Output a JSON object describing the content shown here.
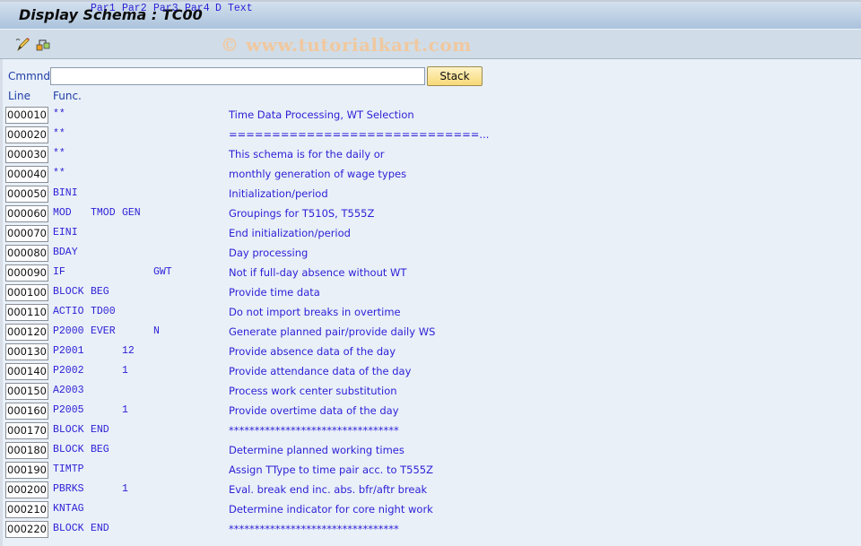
{
  "window": {
    "title": "Display Schema : TC00",
    "watermark": "© www.tutorialkart.com"
  },
  "toolbar": {
    "icons": [
      "display-change-icon",
      "hierarchy-icon"
    ]
  },
  "command": {
    "label": "Cmmnd",
    "value": "",
    "placeholder": "",
    "stack_label": "Stack"
  },
  "columns": {
    "line": "Line",
    "func": "Func.",
    "par1": "Par1",
    "par2": "Par2",
    "par3": "Par3",
    "par4": "Par4",
    "d": "D",
    "text": "Text"
  },
  "rows": [
    {
      "line": "000010",
      "func": "**",
      "par1": "",
      "par2": "",
      "par3": "",
      "par4": "",
      "d": "",
      "text": "Time Data Processing, WT Selection"
    },
    {
      "line": "000020",
      "func": "**",
      "par1": "",
      "par2": "",
      "par3": "",
      "par4": "",
      "d": "",
      "text": "=============================..."
    },
    {
      "line": "000030",
      "func": "**",
      "par1": "",
      "par2": "",
      "par3": "",
      "par4": "",
      "d": "",
      "text": "This schema is for the daily or"
    },
    {
      "line": "000040",
      "func": "**",
      "par1": "",
      "par2": "",
      "par3": "",
      "par4": "",
      "d": "",
      "text": "monthly generation of wage types"
    },
    {
      "line": "000050",
      "func": "BINI",
      "par1": "",
      "par2": "",
      "par3": "",
      "par4": "",
      "d": "",
      "text": "Initialization/period"
    },
    {
      "line": "000060",
      "func": "MOD",
      "par1": "TMOD",
      "par2": "GEN",
      "par3": "",
      "par4": "",
      "d": "",
      "text": "Groupings for T510S, T555Z"
    },
    {
      "line": "000070",
      "func": "EINI",
      "par1": "",
      "par2": "",
      "par3": "",
      "par4": "",
      "d": "",
      "text": "End initialization/period"
    },
    {
      "line": "000080",
      "func": "BDAY",
      "par1": "",
      "par2": "",
      "par3": "",
      "par4": "",
      "d": "",
      "text": "Day processing"
    },
    {
      "line": "000090",
      "func": "IF",
      "par1": "",
      "par2": "",
      "par3": "GWT",
      "par4": "",
      "d": "",
      "text": "Not if full-day absence without WT"
    },
    {
      "line": "000100",
      "func": "BLOCK",
      "par1": "BEG",
      "par2": "",
      "par3": "",
      "par4": "",
      "d": "",
      "text": "Provide time data"
    },
    {
      "line": "000110",
      "func": "ACTIO",
      "par1": "TD00",
      "par2": "",
      "par3": "",
      "par4": "",
      "d": "",
      "text": "Do not import breaks in overtime"
    },
    {
      "line": "000120",
      "func": "P2000",
      "par1": "EVER",
      "par2": "",
      "par3": "N",
      "par4": "",
      "d": "",
      "text": "Generate planned pair/provide daily WS"
    },
    {
      "line": "000130",
      "func": "P2001",
      "par1": "",
      "par2": "12",
      "par3": "",
      "par4": "",
      "d": "",
      "text": "Provide absence data of the day"
    },
    {
      "line": "000140",
      "func": "P2002",
      "par1": "",
      "par2": "1",
      "par3": "",
      "par4": "",
      "d": "",
      "text": "Provide attendance data of the day"
    },
    {
      "line": "000150",
      "func": "A2003",
      "par1": "",
      "par2": "",
      "par3": "",
      "par4": "",
      "d": "",
      "text": "Process work center substitution"
    },
    {
      "line": "000160",
      "func": "P2005",
      "par1": "",
      "par2": "1",
      "par3": "",
      "par4": "",
      "d": "",
      "text": "Provide overtime data of the day"
    },
    {
      "line": "000170",
      "func": "BLOCK",
      "par1": "END",
      "par2": "",
      "par3": "",
      "par4": "",
      "d": "",
      "text": "*********************************"
    },
    {
      "line": "000180",
      "func": "BLOCK",
      "par1": "BEG",
      "par2": "",
      "par3": "",
      "par4": "",
      "d": "",
      "text": "Determine planned working times"
    },
    {
      "line": "000190",
      "func": "TIMTP",
      "par1": "",
      "par2": "",
      "par3": "",
      "par4": "",
      "d": "",
      "text": "Assign TType to time pair acc. to T555Z"
    },
    {
      "line": "000200",
      "func": "PBRKS",
      "par1": "",
      "par2": "1",
      "par3": "",
      "par4": "",
      "d": "",
      "text": "Eval. break end inc. abs. bfr/aftr break"
    },
    {
      "line": "000210",
      "func": "KNTAG",
      "par1": "",
      "par2": "",
      "par3": "",
      "par4": "",
      "d": "",
      "text": "Determine indicator for core night work"
    },
    {
      "line": "000220",
      "func": "BLOCK",
      "par1": "END",
      "par2": "",
      "par3": "",
      "par4": "",
      "d": "",
      "text": "*********************************"
    }
  ]
}
